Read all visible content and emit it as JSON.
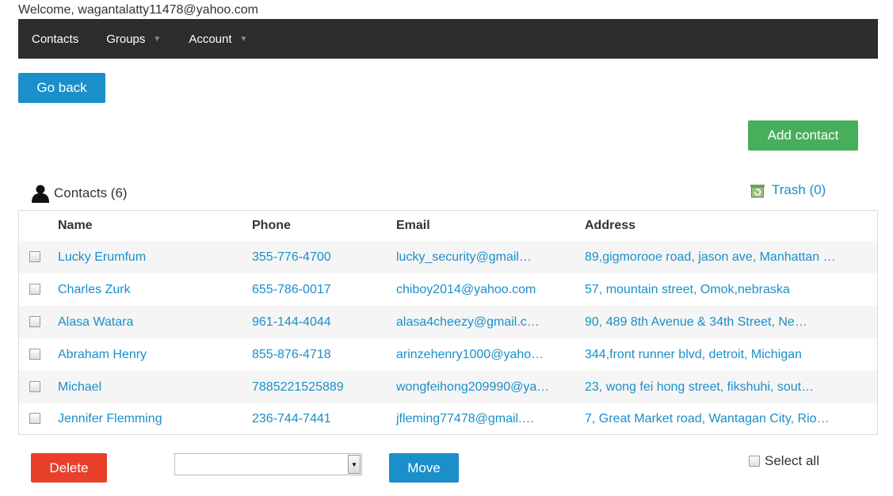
{
  "header": {
    "welcome": "Welcome, wagantalatty11478@yahoo.com"
  },
  "nav": {
    "items": [
      {
        "label": "Contacts",
        "dropdown": false
      },
      {
        "label": "Groups",
        "dropdown": true
      },
      {
        "label": "Account",
        "dropdown": true
      }
    ]
  },
  "actions": {
    "go_back": "Go back",
    "add_contact": "Add contact",
    "delete": "Delete",
    "move": "Move"
  },
  "contacts": {
    "heading": "Contacts (6)",
    "trash": "Trash (0)",
    "columns": [
      "Name",
      "Phone",
      "Email",
      "Address"
    ],
    "rows": [
      {
        "name": "Lucky Erumfum",
        "phone": "355-776-4700",
        "email": "lucky_security@gmail…",
        "address": "89,gigmorooe road, jason ave, Manhattan …"
      },
      {
        "name": "Charles Zurk",
        "phone": "655-786-0017",
        "email": "chiboy2014@yahoo.com",
        "address": "57, mountain street, Omok,nebraska"
      },
      {
        "name": "Alasa Watara",
        "phone": "961-144-4044",
        "email": "alasa4cheezy@gmail.c…",
        "address": "90, 489 8th Avenue & 34th Street, Ne…"
      },
      {
        "name": "Abraham Henry",
        "phone": "855-876-4718",
        "email": "arinzehenry1000@yaho…",
        "address": "344,front runner blvd, detroit, Michigan"
      },
      {
        "name": "Michael",
        "phone": "7885221525889",
        "email": "wongfeihong209990@ya…",
        "address": "23, wong fei hong street, fikshuhi, sout…"
      },
      {
        "name": "Jennifer Flemming",
        "phone": "236-744-7441",
        "email": "jfleming77478@gmail.…",
        "address": "7, Great Market road, Wantagan City, Rio…"
      }
    ]
  },
  "footer": {
    "group_select_value": "",
    "select_all": "Select all"
  },
  "colors": {
    "navbar": "#2d2d2d",
    "primary": "#1a8fc9",
    "success": "#47ae5b",
    "danger": "#e8402b"
  }
}
